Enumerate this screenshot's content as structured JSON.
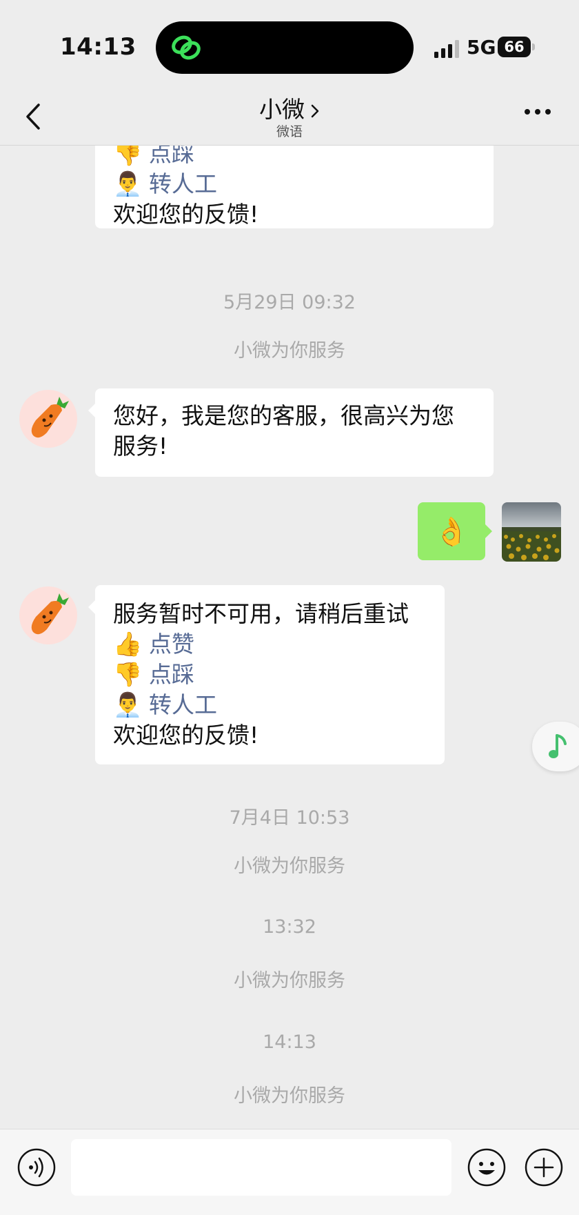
{
  "status": {
    "time": "14:13",
    "network": "5G",
    "battery": "66"
  },
  "nav": {
    "title": "小微",
    "subtitle": "微语"
  },
  "top_bubble": {
    "items": [
      {
        "emoji": "👎",
        "label": "点踩"
      },
      {
        "emoji": "👨‍💼",
        "label": "转人工"
      }
    ],
    "footer": "欢迎您的反馈!"
  },
  "section1": {
    "timestamp": "5月29日 09:32",
    "system": "小微为你服务"
  },
  "greeting": {
    "line1": "您好，我是您的客服，很高兴为您",
    "line2": "服务!"
  },
  "user_message": {
    "emoji": "👌"
  },
  "service_msg": {
    "text": "服务暂时不可用，请稍后重试",
    "items": [
      {
        "emoji": "👍",
        "label": "点赞"
      },
      {
        "emoji": "👎",
        "label": "点踩"
      },
      {
        "emoji": "👨‍💼",
        "label": "转人工"
      }
    ],
    "footer": "欢迎您的反馈!"
  },
  "section2": {
    "timestamp": "7月4日 10:53",
    "system": "小微为你服务"
  },
  "section3": {
    "timestamp": "13:32",
    "system": "小微为你服务"
  },
  "section4": {
    "timestamp": "14:13",
    "system": "小微为你服务"
  },
  "input": {
    "value": ""
  },
  "icons": {
    "island": "link-icon",
    "avatar": "carrot-icon",
    "music": "music-note-icon",
    "voice": "voice-icon",
    "emoji": "smiley-icon",
    "plus": "plus-icon"
  },
  "colors": {
    "link": "#576b95",
    "green_bubble": "#95ec69",
    "background": "#ededed"
  }
}
